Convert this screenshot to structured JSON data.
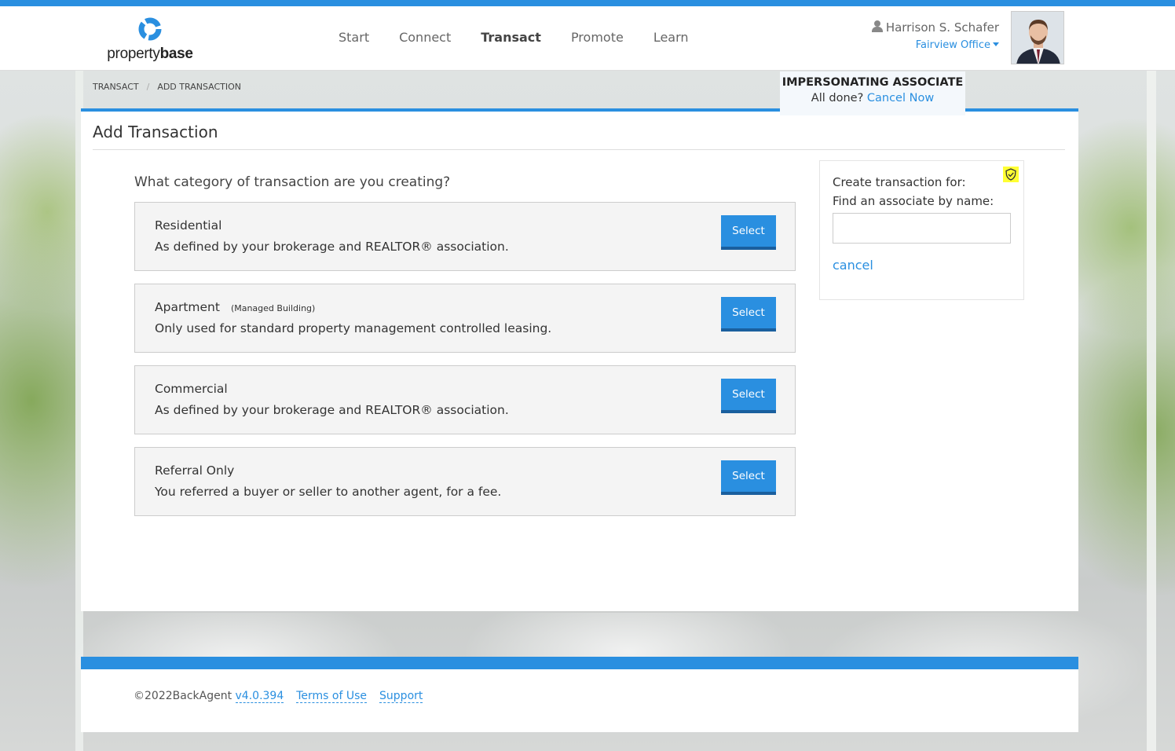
{
  "brand": {
    "logo_prefix": "property",
    "logo_suffix": "base"
  },
  "nav": {
    "items": [
      {
        "label": "Start",
        "active": false
      },
      {
        "label": "Connect",
        "active": false
      },
      {
        "label": "Transact",
        "active": true
      },
      {
        "label": "Promote",
        "active": false
      },
      {
        "label": "Learn",
        "active": false
      }
    ]
  },
  "user": {
    "name": "Harrison S. Schafer",
    "office": "Fairview Office"
  },
  "breadcrumb": {
    "items": [
      "TRANSACT",
      "ADD TRANSACTION"
    ],
    "separator": "/"
  },
  "impersonation": {
    "title": "IMPERSONATING ASSOCIATE",
    "prompt": "All done?",
    "cancel_label": "Cancel Now"
  },
  "main": {
    "title": "Add Transaction",
    "question": "What category of transaction are you creating?",
    "categories": [
      {
        "title": "Residential",
        "subtitle": "",
        "description": "As defined by your brokerage and REALTOR® association.",
        "button_label": "Select"
      },
      {
        "title": "Apartment",
        "subtitle": "(Managed Building)",
        "description": "Only used for standard property management controlled leasing.",
        "button_label": "Select"
      },
      {
        "title": "Commercial",
        "subtitle": "",
        "description": "As defined by your brokerage and REALTOR® association.",
        "button_label": "Select"
      },
      {
        "title": "Referral Only",
        "subtitle": "",
        "description": "You referred a buyer or seller to another agent, for a fee.",
        "button_label": "Select"
      }
    ]
  },
  "associate_search": {
    "label": "Create transaction for:",
    "prompt": "Find an associate by name:",
    "value": "",
    "placeholder": "",
    "cancel_label": "cancel",
    "icon": "shield-check-icon"
  },
  "footer": {
    "copyright": "©2022BackAgent",
    "version": "v4.0.394",
    "terms_label": "Terms of Use",
    "support_label": "Support"
  },
  "colors": {
    "accent": "#2a8fe0",
    "button_shadow": "#1a5f9e",
    "highlight": "#ffff33"
  }
}
